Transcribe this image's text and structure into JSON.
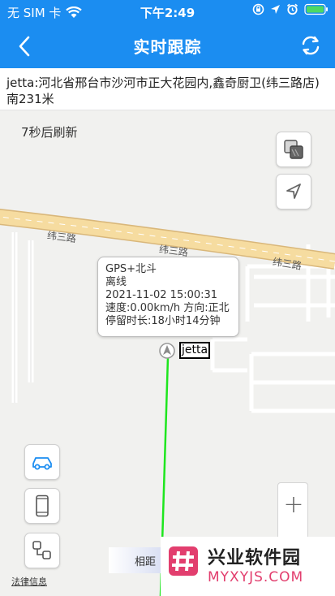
{
  "status_bar": {
    "carrier": "无 SIM 卡",
    "time": "下午2:49"
  },
  "nav": {
    "title": "实时跟踪"
  },
  "address": "jetta:河北省邢台市沙河市正大花园内,鑫奇厨卫(纬三路店)南231米",
  "map": {
    "refresh_countdown": "7秒后刷新",
    "road_labels": [
      "纬三路",
      "纬三路",
      "纬三路"
    ],
    "popup": {
      "line1": "GPS+北斗",
      "line2": "离线",
      "line3": "2021-11-02 15:00:31",
      "line4": "速度:0.00km/h 方向:正北",
      "line5": "停留时长:18小时14分钟"
    },
    "vehicle_label": "jetta",
    "zoom_in": "+",
    "measure_label": "相距",
    "legal_link": "法律信息"
  },
  "watermark": {
    "title": "兴业软件园",
    "url": "MYXYJS.COM",
    "logo_text": "#"
  },
  "colors": {
    "header": "#1b8df1",
    "track": "#1ee61e",
    "road": "#f6dca0",
    "watermark_url": "#e23e6e"
  }
}
